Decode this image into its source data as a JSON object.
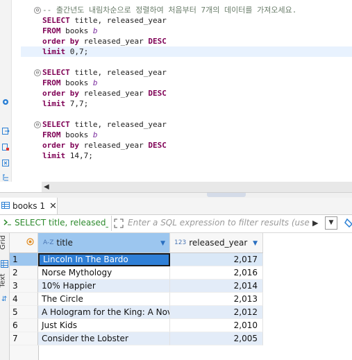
{
  "editor": {
    "comment": "-- 출간년도 내림차순으로 정렬하여 처음부터 7개의 데이터를 가져오세요.",
    "blocks": [
      {
        "select_kw": "SELECT",
        "select_cols": " title, released_year",
        "from_kw": "FROM",
        "table": " books ",
        "alias": "b",
        "order_kw": "order by",
        "order_col": " released_year ",
        "desc_kw": "DESC",
        "limit_kw": "limit",
        "limit_val": " 0,7;"
      },
      {
        "select_kw": "SELECT",
        "select_cols": " title, released_year",
        "from_kw": "FROM",
        "table": " books ",
        "alias": "b",
        "order_kw": "order by",
        "order_col": " released_year ",
        "desc_kw": "DESC",
        "limit_kw": "limit",
        "limit_val": " 7,7;"
      },
      {
        "select_kw": "SELECT",
        "select_cols": " title, released_year",
        "from_kw": "FROM",
        "table": " books ",
        "alias": "b",
        "order_kw": "order by",
        "order_col": " released_year ",
        "desc_kw": "DESC",
        "limit_kw": "limit",
        "limit_val": " 14,7;"
      }
    ]
  },
  "result_tab": {
    "label": "books 1",
    "close": "✕"
  },
  "filter": {
    "sql": "SELECT title, released_yea",
    "placeholder": "Enter a SQL expression to filter results (use Ctrl+"
  },
  "side_tabs": {
    "grid": "Grid",
    "text": "Text"
  },
  "columns": [
    {
      "type": "A-Z",
      "name": "title"
    },
    {
      "type": "123",
      "name": "released_year"
    }
  ],
  "rows": [
    {
      "num": "1",
      "title": "Lincoln In The Bardo",
      "year": "2,017"
    },
    {
      "num": "2",
      "title": "Norse Mythology",
      "year": "2,016"
    },
    {
      "num": "3",
      "title": "10% Happier",
      "year": "2,014"
    },
    {
      "num": "4",
      "title": "The Circle",
      "year": "2,013"
    },
    {
      "num": "5",
      "title": "A Hologram for the King: A Novel",
      "year": "2,012"
    },
    {
      "num": "6",
      "title": "Just Kids",
      "year": "2,010"
    },
    {
      "num": "7",
      "title": "Consider the Lobster",
      "year": "2,005"
    }
  ]
}
